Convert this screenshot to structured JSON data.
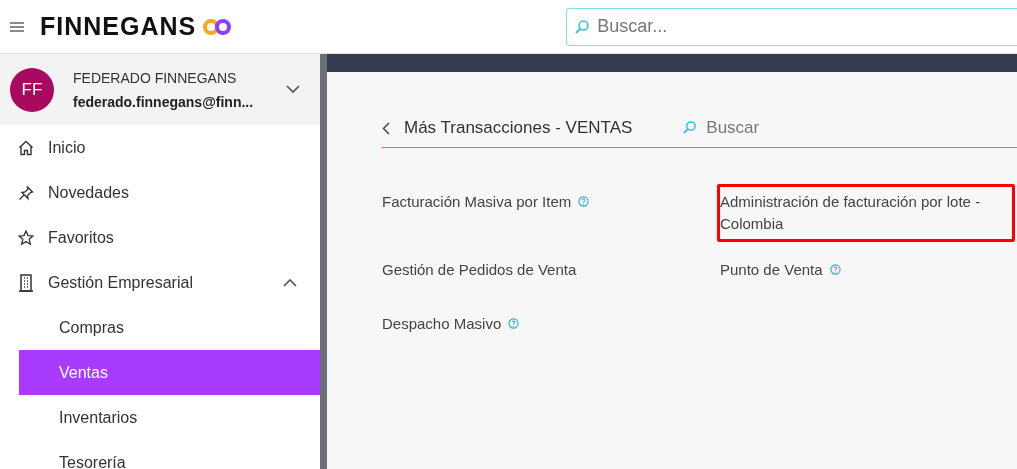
{
  "header": {
    "brand": "FINNEGANS",
    "search": {
      "placeholder": "Buscar..."
    }
  },
  "user": {
    "initials": "FF",
    "name": "FEDERADO FINNEGANS",
    "email": "federado.finnegans@finn...",
    "expanded": false
  },
  "sidebar": {
    "items": [
      {
        "label": "Inicio",
        "selected": false
      },
      {
        "label": "Novedades",
        "selected": false
      },
      {
        "label": "Favoritos",
        "selected": false
      },
      {
        "label": "Gestión Empresarial",
        "expanded": true,
        "selected": false,
        "children": [
          {
            "label": "Compras",
            "selected": false
          },
          {
            "label": "Ventas",
            "selected": true
          },
          {
            "label": "Inventarios",
            "selected": false
          },
          {
            "label": "Tesorería",
            "selected": false
          }
        ]
      }
    ]
  },
  "page": {
    "title": "Más Transacciones - VENTAS",
    "search": {
      "placeholder": "Buscar"
    },
    "items": [
      {
        "label": "Facturación Masiva por Item",
        "help": true,
        "highlighted": false
      },
      {
        "label": "Administración de facturación por lote - Colombia",
        "help": false,
        "highlighted": true
      },
      {
        "label": "Gestión de Pedidos de Venta",
        "help": false,
        "highlighted": false
      },
      {
        "label": "Punto de Venta",
        "help": true,
        "highlighted": false
      },
      {
        "label": "Despacho Masivo",
        "help": true,
        "highlighted": false
      }
    ]
  }
}
